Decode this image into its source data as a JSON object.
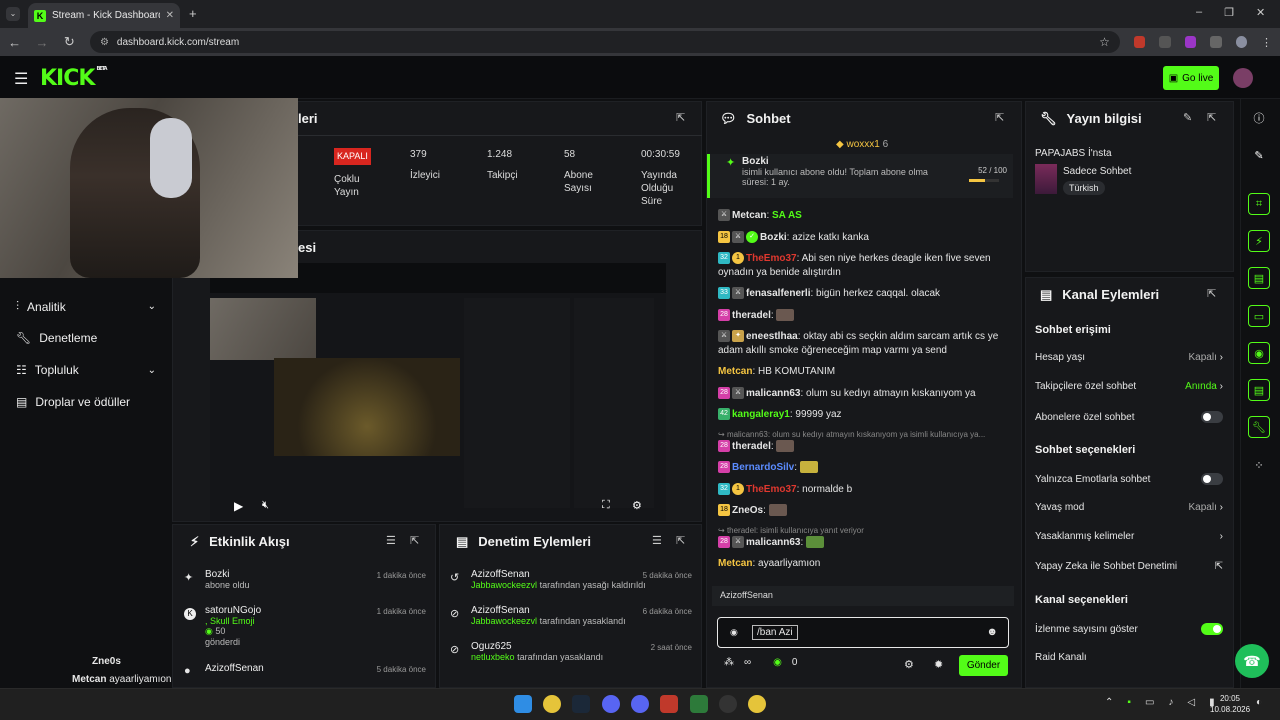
{
  "browser": {
    "tab_title": "Stream - Kick Dashboard",
    "url": "dashboard.kick.com/stream"
  },
  "header": {
    "logo": "KICK",
    "beta": "BETA",
    "go_live": "Go live"
  },
  "sidebar": {
    "items": [
      {
        "label": "Analitik"
      },
      {
        "label": "Denetleme"
      },
      {
        "label": "Topluluk"
      },
      {
        "label": "Droplar ve ödüller"
      }
    ]
  },
  "stats_panel": {
    "title_fragment": "leri",
    "status_badge": "KAPALI",
    "status_label": "Çoklu Yayın",
    "viewers": "379",
    "viewers_label": "İzleyici",
    "followers": "1.248",
    "followers_label": "Takipçi",
    "subs": "58",
    "subs_label": "Abone Sayısı",
    "uptime": "00:30:59",
    "uptime_label": "Yayında Olduğu Süre"
  },
  "preview_panel": {
    "title_fragment": "esi"
  },
  "activity": {
    "title": "Etkinlik Akışı",
    "items": [
      {
        "name": "Bozki",
        "sub": "abone oldu",
        "time": "1 dakika önce"
      },
      {
        "name": "satoruNGojo",
        "sub": ", Skull Emoji",
        "extra": "50",
        "extra2": "gönderdi",
        "time": "1 dakika önce"
      },
      {
        "name": "AzizoffSenan",
        "sub": "",
        "time": "5 dakika önce"
      }
    ]
  },
  "moderation": {
    "title": "Denetim Eylemleri",
    "items": [
      {
        "name": "AzizoffSenan",
        "sub_user": "Jabbawockeezvl",
        "sub": "tarafından yasağı kaldırıldı",
        "time": "5 dakika önce"
      },
      {
        "name": "AzizoffSenan",
        "sub_user": "Jabbawockeezvl",
        "sub": "tarafından yasaklandı",
        "time": "6 dakika önce"
      },
      {
        "name": "Oguz625",
        "sub_user": "netluxbeko",
        "sub": "tarafından yasaklandı",
        "time": "2 saat önce"
      }
    ]
  },
  "chat": {
    "title": "Sohbet",
    "pinned_user": "woxxx1",
    "pinned_count": "6",
    "sub_alert": {
      "user": "Bozki",
      "text": "isimli kullanıcı abone oldu! Toplam abone olma süresi: 1 ay.",
      "progress": "52 / 100",
      "progress_value": 52
    },
    "messages": [
      {
        "user": "Metcan",
        "text": "SA AS"
      },
      {
        "user": "Bozki",
        "text": "azize katkı kanka"
      },
      {
        "user": "TheEmo37",
        "text": "Abi sen niye herkes deagle iken five seven oynadın ya benide alıştırdın"
      },
      {
        "user": "fenasalfenerli",
        "text": "bigün herkez caqqal. olacak"
      },
      {
        "user": "theradel",
        "text": ""
      },
      {
        "user": "eneestlhaa",
        "text": "oktay abi cs seçkin aldım sarcam artık cs ye adam akıllı smoke öğreneceğim map varmı ya send"
      },
      {
        "user": "Metcan",
        "text": "HB KOMUTANIM"
      },
      {
        "user": "malicann63",
        "text": "olum su kedıyı atmayın kıskanıyom ya"
      },
      {
        "user": "kangaleray1",
        "text": "99999 yaz"
      },
      {
        "reply": "malicann63: olum su kedıyı atmayın kıskanıyom ya isimli kullanıcıya ya..."
      },
      {
        "user": "theradel",
        "text": ""
      },
      {
        "user": "BernardoSilv",
        "text": ""
      },
      {
        "user": "TheEmo37",
        "text": "normalde b"
      },
      {
        "user": "ZneOs",
        "text": ""
      },
      {
        "reply": "theradel:  isimli kullanıcıya yanıt veriyor"
      },
      {
        "user": "malicann63",
        "text": ""
      },
      {
        "user": "Metcan",
        "text": "ayaarliyamıon"
      }
    ],
    "reply_user": "AzizoffSenan",
    "input_value": "/ban Azi",
    "points": "0",
    "send": "Gönder"
  },
  "stream_info": {
    "title": "Yayın bilgisi",
    "stream_title": "PAPAJABS İ'nsta",
    "chat_mode": "Sadece Sohbet",
    "language": "Türkish"
  },
  "channel_actions": {
    "title": "Kanal Eylemleri",
    "chat_access": "Sohbet erişimi",
    "account_age": "Hesap yaşı",
    "account_age_val": "Kapalı",
    "followers_only": "Takipçilere özel sohbet",
    "followers_only_val": "Anında",
    "subs_only": "Abonelere özel sohbet",
    "chat_options": "Sohbet seçenekleri",
    "emote_only": "Yalnızca Emotlarla sohbet",
    "slow_mode": "Yavaş mod",
    "slow_mode_val": "Kapalı",
    "banned_words": "Yasaklanmış kelimeler",
    "ai_mod": "Yapay Zeka ile Sohbet Denetimi",
    "channel_options": "Kanal seçenekleri",
    "show_viewers": "İzlenme sayısını göster",
    "raid": "Raid Kanalı"
  },
  "overlay": {
    "user1": "Zne0s",
    "user2": "Metcan",
    "text2": "ayaarliyamıon"
  },
  "taskbar": {
    "time": "20:05",
    "date": "10.08.2026"
  },
  "colors": {
    "accent": "#53fc18",
    "bg": "#0f1012",
    "panel": "#17181b"
  }
}
